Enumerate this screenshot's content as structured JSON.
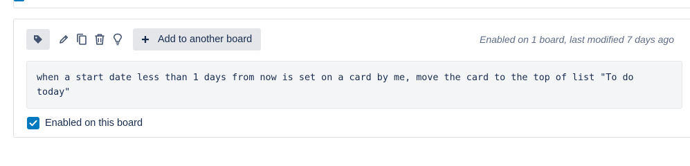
{
  "toolbar": {
    "tag_icon": "tag-icon",
    "edit_icon": "pencil-icon",
    "copy_icon": "copy-icon",
    "delete_icon": "trash-icon",
    "idea_icon": "lightbulb-icon",
    "add_to_board_label": "Add to another board"
  },
  "rule": {
    "status_text": "Enabled on 1 board, last modified 7 days ago",
    "command_text": "when a start date less than 1 days from now is set on a card by me, move the card to the top of list \"To do today\"",
    "enabled_label": "Enabled on this board",
    "enabled_checked": true
  },
  "colors": {
    "accent": "#0079bf",
    "button_bg": "#e4e6ea",
    "code_bg": "#f4f5f7",
    "muted_text": "#5e6c84"
  }
}
